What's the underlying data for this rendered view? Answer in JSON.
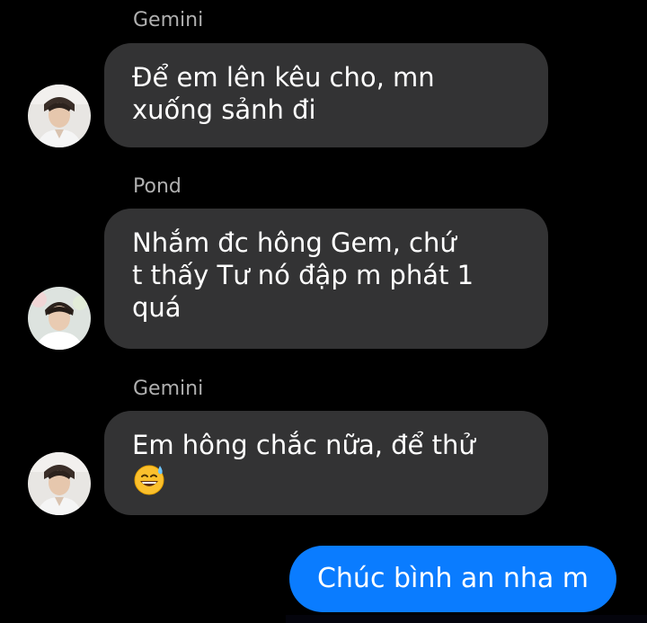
{
  "messages": [
    {
      "sender": "Gemini",
      "lines": [
        "Để em lên kêu cho, mn",
        "xuống sảnh đi"
      ],
      "avatar": "gemini-avatar"
    },
    {
      "sender": "Pond",
      "lines": [
        "Nhắm đc hông Gem, chứ",
        "t thấy Tư nó đập m phát 1",
        "quá"
      ],
      "avatar": "pond-avatar"
    },
    {
      "sender": "Gemini",
      "lines": [
        "Em hông chắc nữa, để thử"
      ],
      "emoji": "grinning-face-with-sweat-emoji",
      "avatar": "gemini-avatar"
    }
  ],
  "outgoing": {
    "text": "Chúc bình an nha m"
  },
  "colors": {
    "background": "#000000",
    "incoming_bubble": "#333334",
    "outgoing_bubble": "#0a7cff",
    "sender_name": "#b0b0b0",
    "text": "#ffffff"
  }
}
